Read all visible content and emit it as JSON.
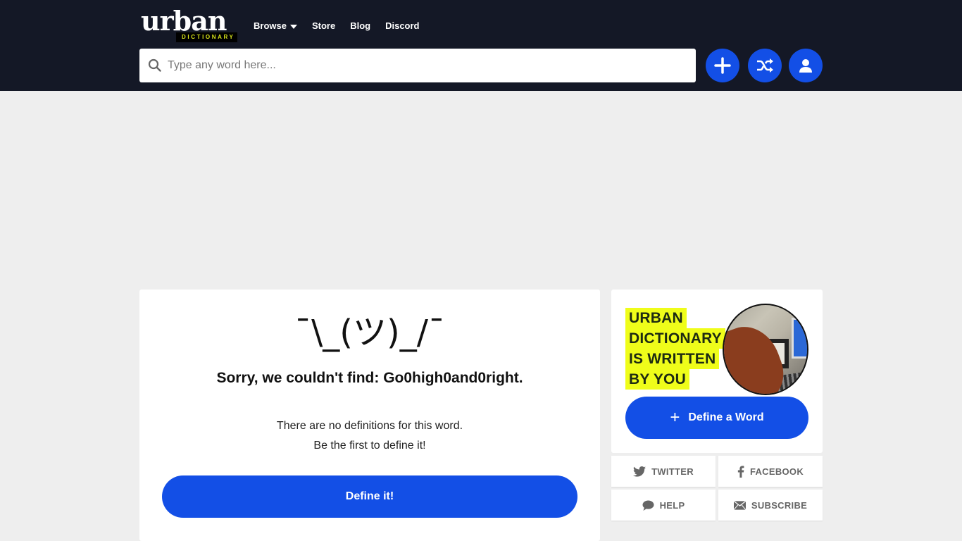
{
  "header": {
    "logo": {
      "word": "urban",
      "sub": "DICTIONARY"
    },
    "nav": [
      {
        "label": "Browse",
        "has_dropdown": true
      },
      {
        "label": "Store"
      },
      {
        "label": "Blog"
      },
      {
        "label": "Discord"
      }
    ],
    "search": {
      "placeholder": "Type any word here...",
      "value": ""
    },
    "actions": [
      {
        "name": "add",
        "icon": "plus-icon"
      },
      {
        "name": "random",
        "icon": "shuffle-icon"
      },
      {
        "name": "account",
        "icon": "user-icon"
      }
    ]
  },
  "main": {
    "shrug": "¯\\_(ツ)_/¯",
    "sorry_text": "Sorry, we couldn't find: Go0high0and0right.",
    "no_definitions": "There are no definitions for this word.",
    "be_first": "Be the first to define it!",
    "define_button": "Define it!"
  },
  "sidebar": {
    "promo_lines": [
      "URBAN",
      "DICTIONARY",
      "IS WRITTEN",
      "BY YOU"
    ],
    "define_word_button": "Define a Word",
    "social": [
      {
        "label": "TWITTER",
        "icon": "twitter-icon"
      },
      {
        "label": "FACEBOOK",
        "icon": "facebook-icon"
      },
      {
        "label": "HELP",
        "icon": "chat-icon"
      },
      {
        "label": "SUBSCRIBE",
        "icon": "envelope-icon"
      }
    ]
  },
  "colors": {
    "header_bg": "#141826",
    "accent_blue": "#134fe6",
    "highlight_yellow": "#effd1a",
    "page_bg": "#eeeeee"
  }
}
